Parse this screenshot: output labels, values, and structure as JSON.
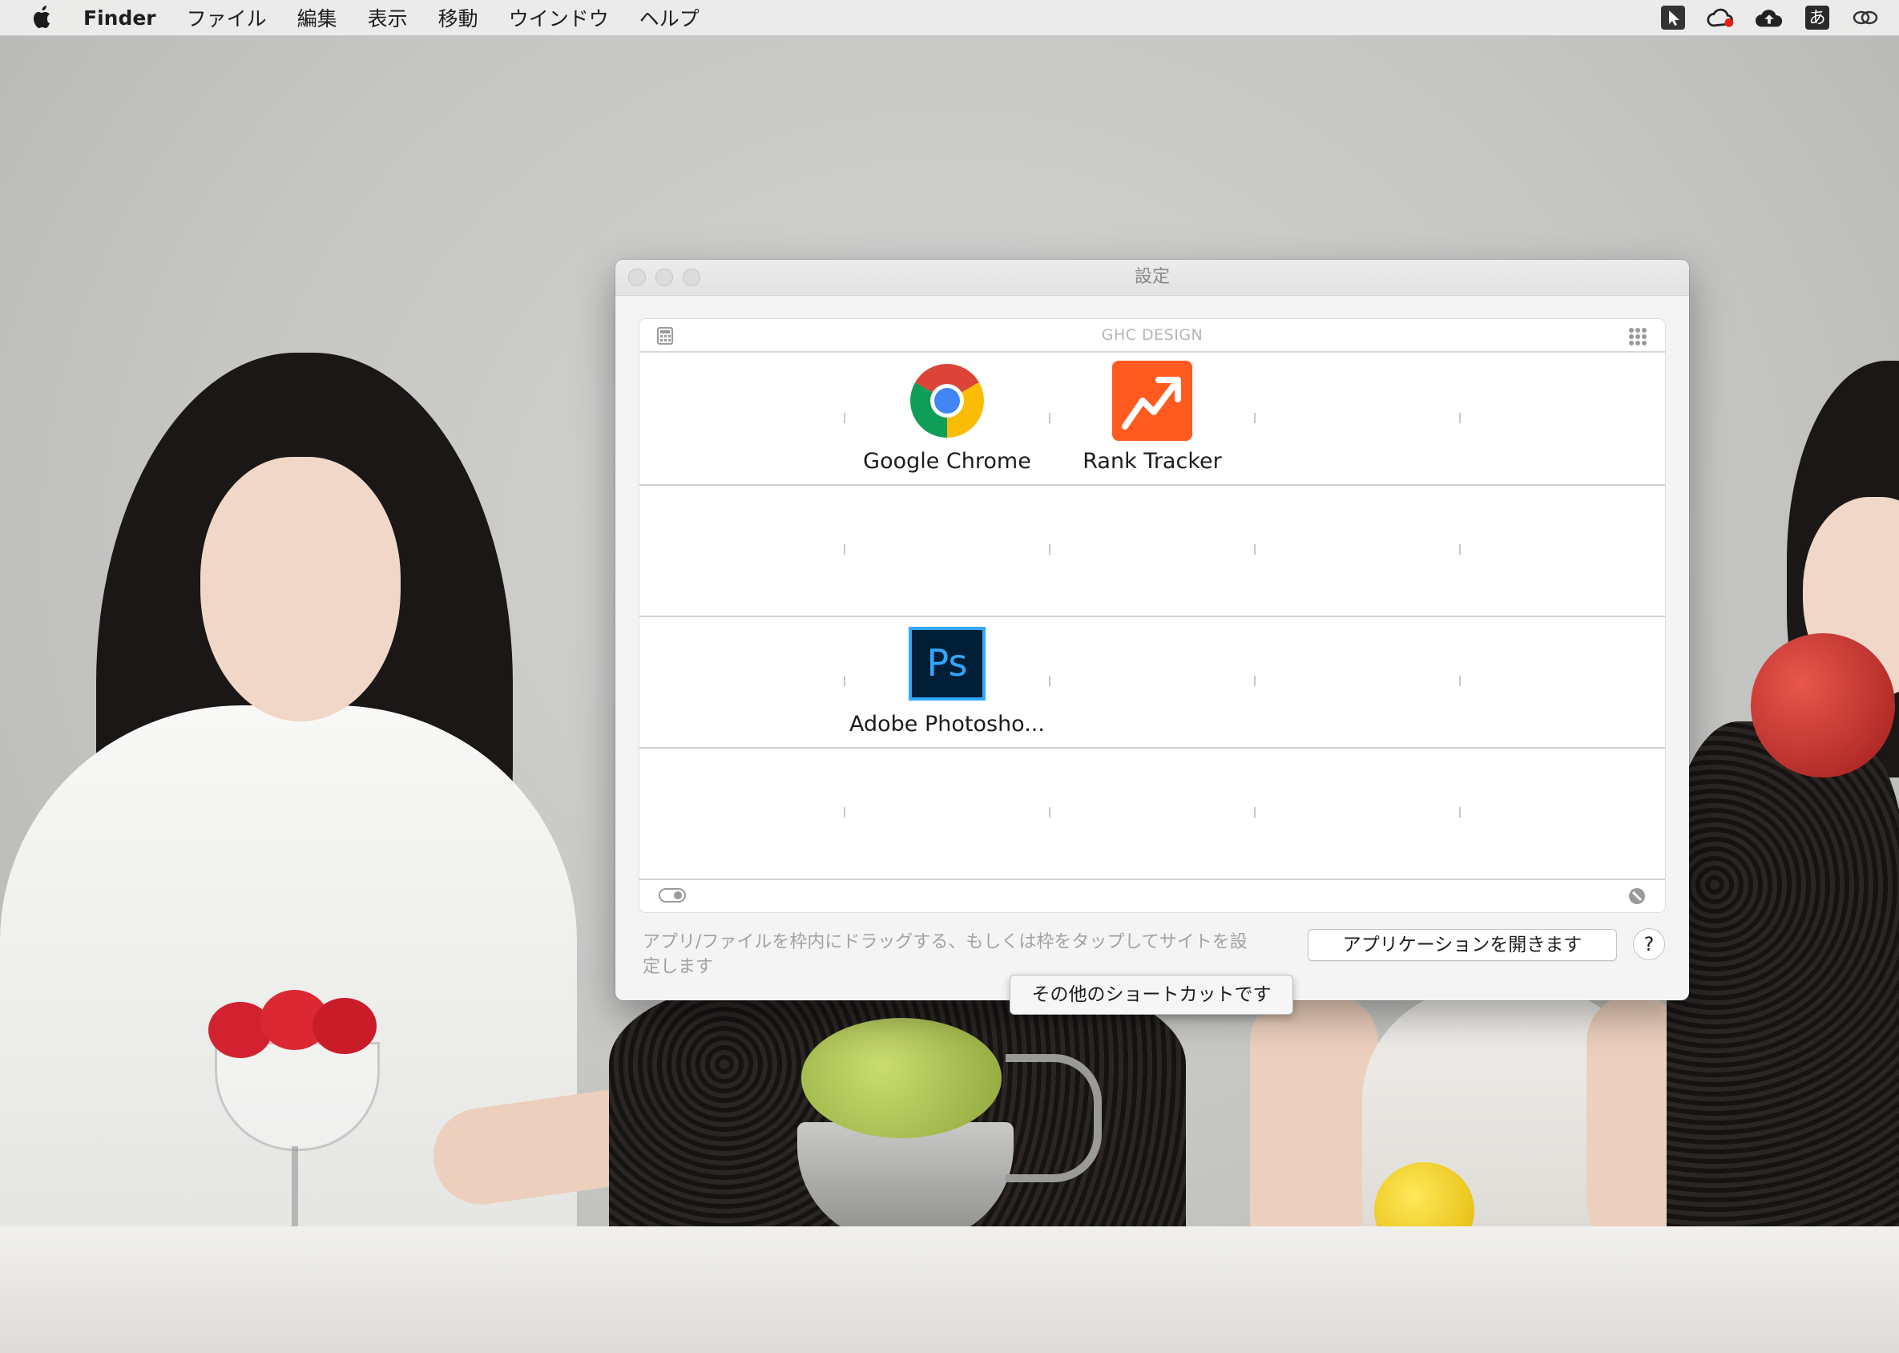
{
  "menubar": {
    "app_name": "Finder",
    "items": [
      "ファイル",
      "編集",
      "表示",
      "移動",
      "ウインドウ",
      "ヘルプ"
    ],
    "status_icons": [
      "cursor-icon",
      "creative-cloud-icon",
      "cloud-upload-icon",
      "input-method-icon",
      "link-icon"
    ],
    "input_method_label": "あ"
  },
  "window": {
    "title": "設定",
    "brand": "GHC DESIGN",
    "apps": [
      {
        "label": "Google Chrome",
        "icon": "chrome-icon"
      },
      {
        "label": "Rank Tracker",
        "icon": "rank-tracker-icon",
        "color": "#ff5a1f"
      },
      {
        "label": "Adobe Photosho...",
        "icon": "photoshop-icon",
        "icon_text": "Ps",
        "color": "#31a8ff"
      }
    ],
    "hint": "アプリ/ファイルを枠内にドラッグする、もしくは枠をタップしてサイトを設定します",
    "open_apps_button": "アプリケーションを開きます",
    "help_button": "?",
    "tooltip": "その他のショートカットです"
  }
}
